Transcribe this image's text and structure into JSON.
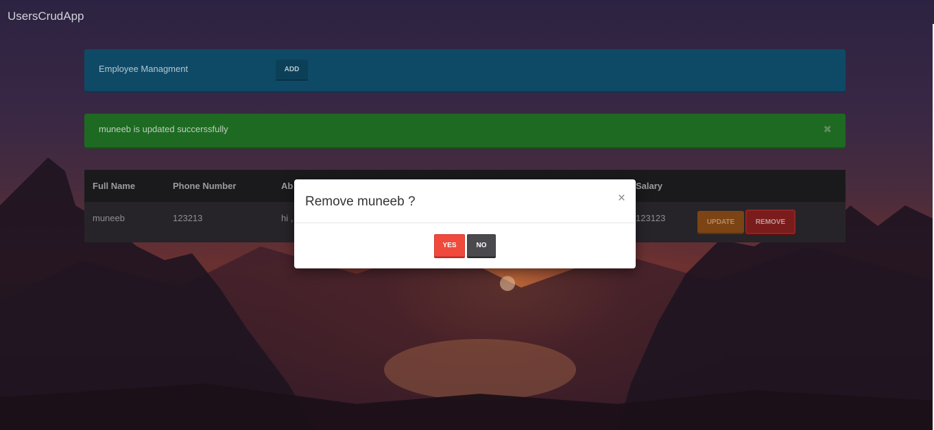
{
  "app": {
    "brand": "UsersCrudApp"
  },
  "panel": {
    "title": "Employee Managment",
    "add_label": "ADD"
  },
  "alert": {
    "message": "muneeb is updated succerssfully",
    "close_glyph": "✖"
  },
  "table": {
    "headers": [
      "Full Name",
      "Phone Number",
      "Ab",
      "Salary"
    ],
    "rows": [
      {
        "full_name": "muneeb",
        "phone": "123213",
        "about": "hi ,",
        "salary": "123123"
      }
    ],
    "update_label": "UPDATE",
    "remove_label": "REMOVE"
  },
  "modal": {
    "title": "Remove muneeb ?",
    "close_glyph": "×",
    "yes_label": "YES",
    "no_label": "NO"
  },
  "colors": {
    "panel_blue": "#0e4a66",
    "alert_green": "#1e6a22",
    "btn_yes": "#f04a3c",
    "btn_no": "#4a4a4e"
  }
}
